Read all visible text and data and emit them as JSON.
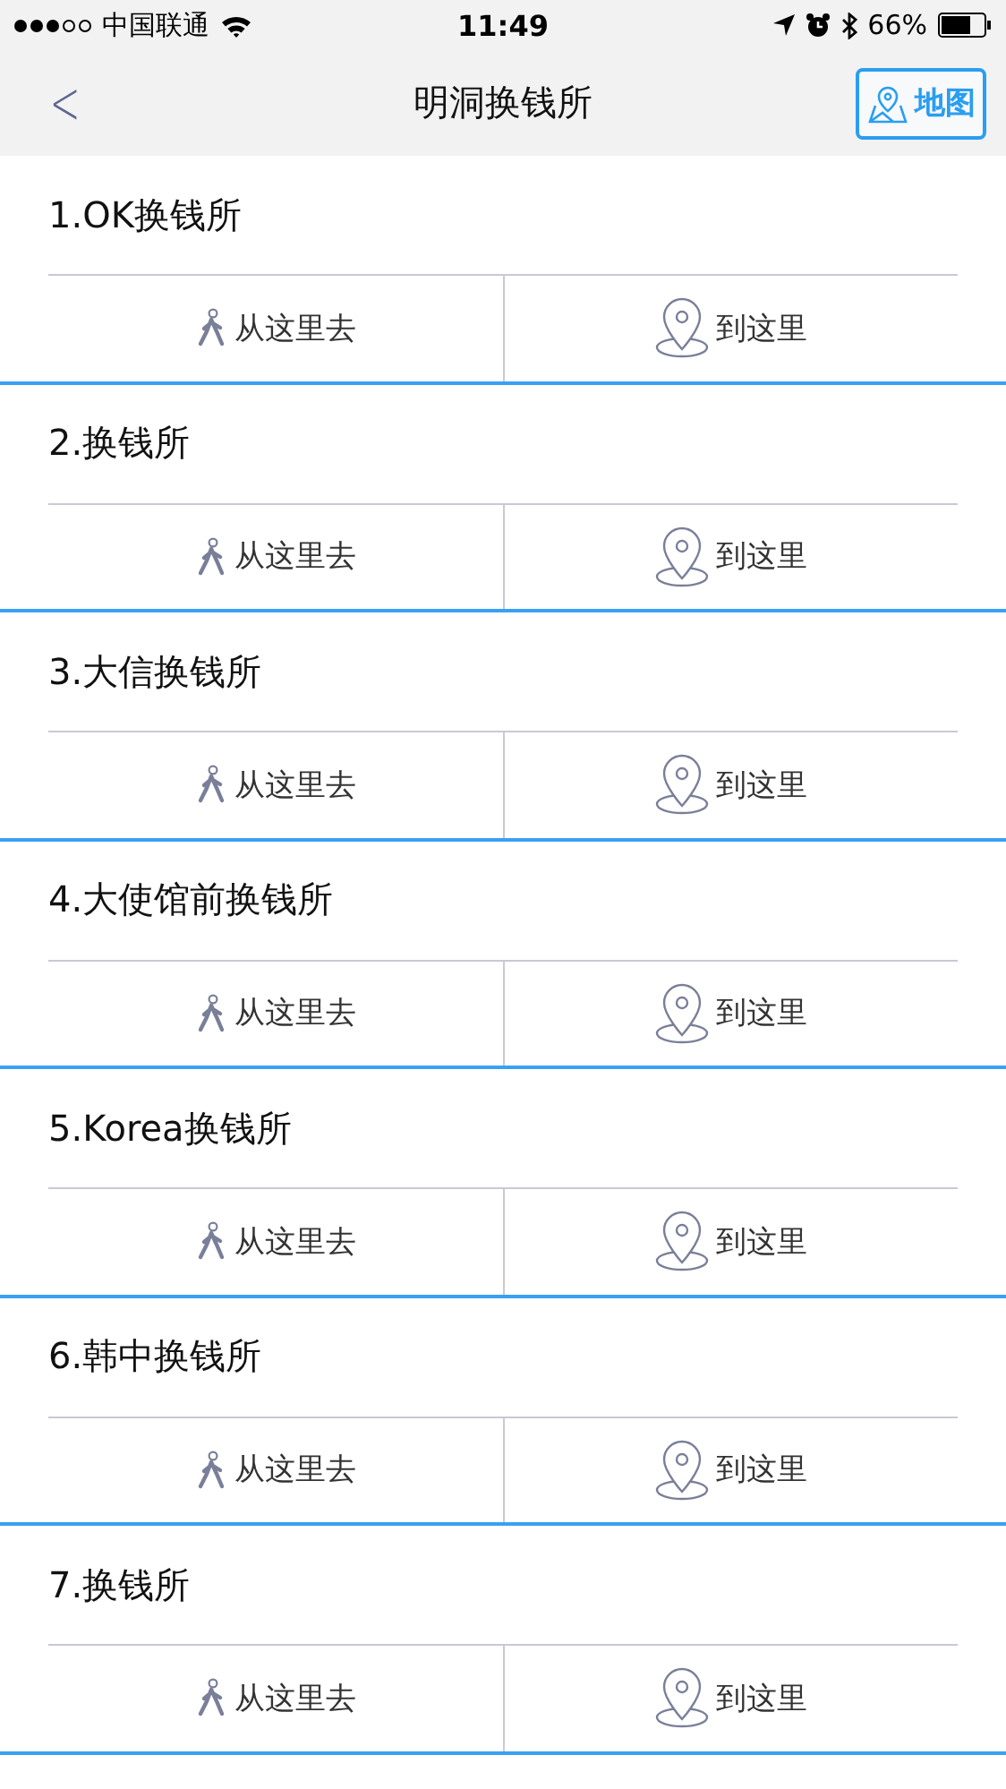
{
  "status_bar": {
    "signal_dots": [
      true,
      true,
      true,
      false,
      false
    ],
    "carrier": "中国联通",
    "time": "11:49",
    "battery": "66%"
  },
  "nav": {
    "back": "<",
    "title": "明洞换钱所",
    "map_button": "地图"
  },
  "places": [
    {
      "name": "1.OK换钱所",
      "from_here": "从这里去",
      "to_here": "到这里"
    },
    {
      "name": "2.换钱所",
      "from_here": "从这里去",
      "to_here": "到这里"
    },
    {
      "name": "3.大信换钱所",
      "from_here": "从这里去",
      "to_here": "到这里"
    },
    {
      "name": "4.大使馆前换钱所",
      "from_here": "从这里去",
      "to_here": "到这里"
    },
    {
      "name": "5.Korea换钱所",
      "from_here": "从这里去",
      "to_here": "到这里"
    },
    {
      "name": "6.韩中换钱所",
      "from_here": "从这里去",
      "to_here": "到这里"
    },
    {
      "name": "7.换钱所",
      "from_here": "从这里去",
      "to_here": "到这里"
    }
  ]
}
